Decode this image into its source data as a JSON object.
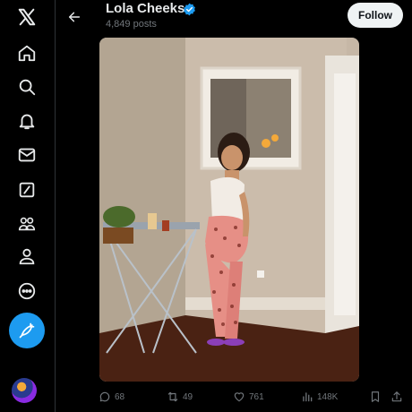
{
  "header": {
    "profile_name": "Lola Cheeks",
    "post_count": "4,849 posts",
    "follow_label": "Follow"
  },
  "sidebar": {
    "items": [
      {
        "icon": "x-logo-icon"
      },
      {
        "icon": "home-icon"
      },
      {
        "icon": "search-icon"
      },
      {
        "icon": "notifications-bell-icon"
      },
      {
        "icon": "messages-mail-icon"
      },
      {
        "icon": "grok-icon"
      },
      {
        "icon": "communities-icon"
      },
      {
        "icon": "profile-icon"
      },
      {
        "icon": "more-icon"
      },
      {
        "icon": "compose-post-icon"
      }
    ]
  },
  "actions": {
    "replies": "68",
    "reposts": "49",
    "likes": "761",
    "views": "148K"
  },
  "colors": {
    "accent": "#1d9bf0",
    "background": "#000000",
    "text": "#e7e9ea",
    "muted": "#71767b"
  }
}
